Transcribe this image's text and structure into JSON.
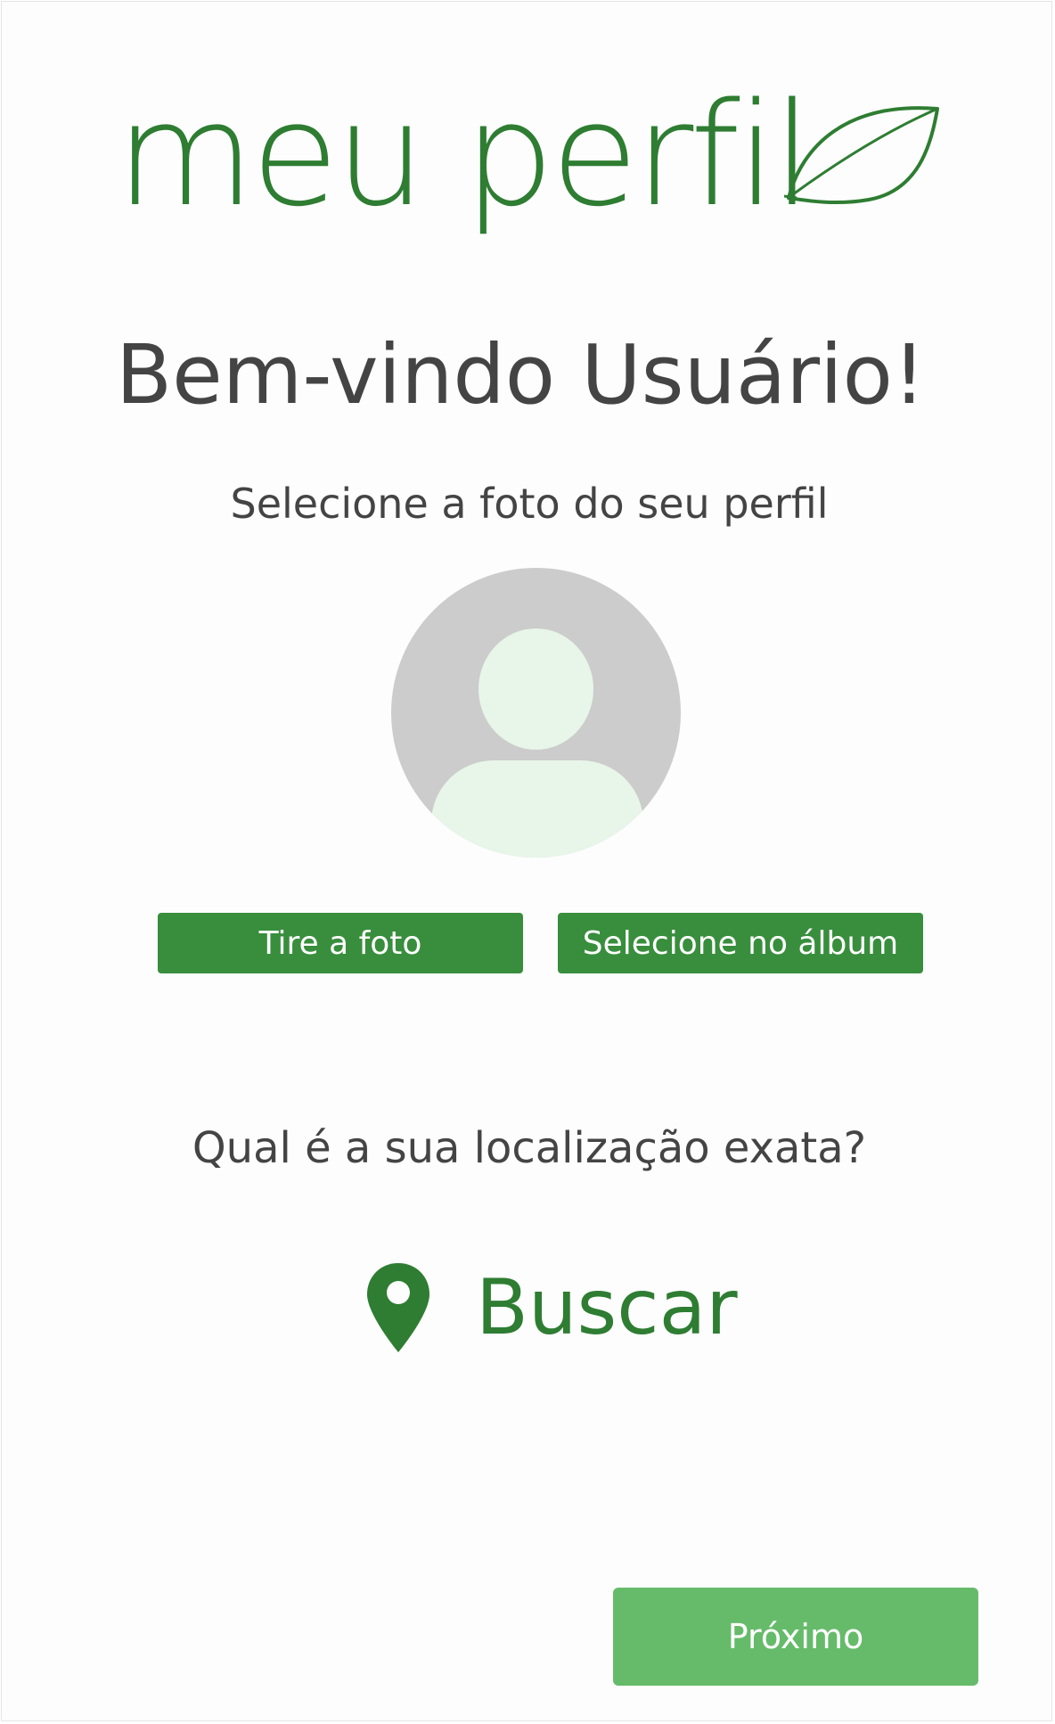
{
  "header": {
    "app_title": "meu perfil",
    "logo_icon": "leaf-icon"
  },
  "main": {
    "welcome": "Bem-vindo Usuário!",
    "photo_prompt": "Selecione a foto do seu perfil",
    "avatar_icon": "user-placeholder-icon",
    "take_photo_label": "Tire a foto",
    "select_album_label": "Selecione no álbum",
    "location_question": "Qual é a sua localização exata?",
    "search_icon": "map-pin-icon",
    "search_label": "Buscar"
  },
  "footer": {
    "next_label": "Próximo"
  },
  "colors": {
    "brand_green": "#2e7d32",
    "button_green": "#388e3c",
    "next_button_green": "#66bb6a",
    "avatar_bg": "#cccccc",
    "avatar_fg": "#e8f5e9",
    "text_gray": "#444444"
  }
}
